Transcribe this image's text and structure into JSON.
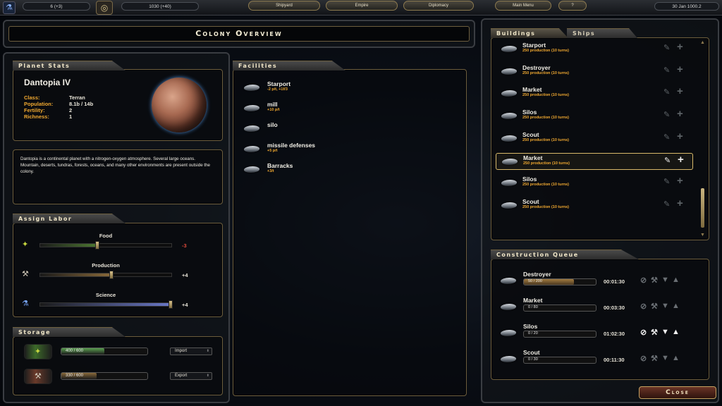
{
  "topbar": {
    "res1": "6 (+3)",
    "res2": "1030 (+40)",
    "nav": [
      "Shipyard",
      "Empire",
      "Diplomacy"
    ],
    "main_menu": "Main Menu",
    "help": "?",
    "date": "30 Jan 1000.2"
  },
  "title": "Colony Overview",
  "planet": {
    "section": "Planet Stats",
    "name": "Dantopia IV",
    "stats": [
      {
        "label": "Class:",
        "value": "Terran"
      },
      {
        "label": "Population:",
        "value": "8.1b / 14b"
      },
      {
        "label": "Fertility:",
        "value": "2"
      },
      {
        "label": "Richness:",
        "value": "1"
      }
    ],
    "description": "Dantopia is a continental planet with a nitrogen-oxygen atmosphere. Several large oceans. Mountain, deserts, tundras, forests, oceans, and many other environments are present outside the colony."
  },
  "labor": {
    "section": "Assign Labor",
    "rows": [
      {
        "label": "Food",
        "delta": "-3",
        "level": 0.44,
        "color": "#4e7a32",
        "delta_color": "#e04a3a"
      },
      {
        "label": "Production",
        "delta": "+4",
        "level": 0.55,
        "color": "#8a6a3a",
        "delta_color": "#e8e4d8"
      },
      {
        "label": "Science",
        "delta": "+4",
        "level": 1.0,
        "color": "#6a78c8",
        "delta_color": "#e8e4d8"
      }
    ]
  },
  "storage": {
    "section": "Storage",
    "rows": [
      {
        "value": "400 / 600",
        "fraction": 0.667,
        "color": "#5aa050",
        "button": "Import"
      },
      {
        "value": "330 / 600",
        "fraction": 0.55,
        "color": "#8a6a3a",
        "button": "Export"
      }
    ]
  },
  "facilities": {
    "section": "Facilities",
    "items": [
      {
        "name": "Starport",
        "sub": "-2 p/t, +1f/3"
      },
      {
        "name": "mill",
        "sub": "+10 p/t"
      },
      {
        "name": "silo",
        "sub": ""
      },
      {
        "name": "missile defenses",
        "sub": "+5 p/t"
      },
      {
        "name": "Barracks",
        "sub": "+3/t"
      }
    ]
  },
  "buildings": {
    "tabs": [
      "Buildings",
      "Ships"
    ],
    "items": [
      {
        "name": "Starport",
        "sub": "250 production (10 turns)"
      },
      {
        "name": "Destroyer",
        "sub": "250 production (10 turns)"
      },
      {
        "name": "Market",
        "sub": "250 production (10 turns)"
      },
      {
        "name": "Silos",
        "sub": "250 production (10 turns)"
      },
      {
        "name": "Scout",
        "sub": "250 production (10 turns)"
      },
      {
        "name": "Market",
        "sub": "250 production (10 turns)"
      },
      {
        "name": "Silos",
        "sub": "250 production (10 turns)"
      },
      {
        "name": "Scout",
        "sub": "250 production (10 turns)"
      }
    ],
    "selected_index": 5
  },
  "queue": {
    "section": "Construction Queue",
    "items": [
      {
        "name": "Destroyer",
        "progress": "50 / 200",
        "fraction": 0.25,
        "time": "00:01:30"
      },
      {
        "name": "Market",
        "progress": "0 / 80",
        "fraction": 0,
        "time": "00:03:30"
      },
      {
        "name": "Silos",
        "progress": "0 / 20",
        "fraction": 0,
        "time": "01:02:30"
      },
      {
        "name": "Scout",
        "progress": "0 / 30",
        "fraction": 0,
        "time": "00:11:30"
      }
    ],
    "highlight_index": 2
  },
  "close": "Close"
}
